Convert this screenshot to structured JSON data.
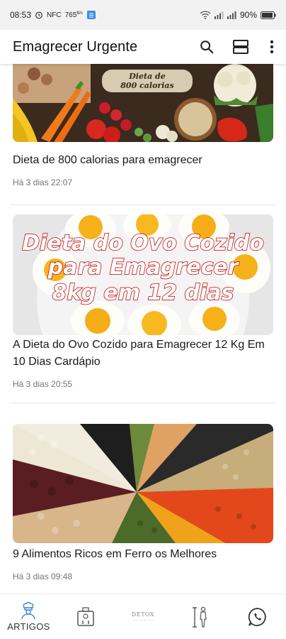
{
  "status_bar": {
    "time": "08:53",
    "nfc": "NFC",
    "network_speed": "765",
    "network_unit": "B/s",
    "battery": "90%"
  },
  "app_bar": {
    "title": "Emagrecer Urgente",
    "icons": [
      "search-icon",
      "view-toggle-icon",
      "more-vert-icon"
    ]
  },
  "articles": [
    {
      "title": "Dieta de 800 calorias para emagrecer",
      "time": "Há 3 dias 22:07",
      "image_caption_line1": "Dieta de",
      "image_caption_line2": "800 calorias"
    },
    {
      "title": "A Dieta do Ovo Cozido para Emagrecer 12 Kg Em 10 Dias Cardápio",
      "time": "Há 3 dias 20:55",
      "image_caption_line1": "Dieta do Ovo Cozido",
      "image_caption_line2": "para Emagrecer",
      "image_caption_line3": "8kg em 12 dias"
    },
    {
      "title": "9 Alimentos Ricos em Ferro os Melhores",
      "time": "Há 3 dias 09:48"
    }
  ],
  "bottom_nav": {
    "items": [
      {
        "label": "ARTIGOS",
        "icon": "chef-icon"
      },
      {
        "label": "",
        "icon": "scale-icon"
      },
      {
        "label": "",
        "icon": "detox-icon",
        "logo_text": "DETOX"
      },
      {
        "label": "",
        "icon": "measure-icon"
      },
      {
        "label": "",
        "icon": "whatsapp-icon"
      }
    ]
  },
  "colors": {
    "accent": "#1e88e5",
    "egg_title_red": "#c10000",
    "time_gray": "#757575"
  }
}
